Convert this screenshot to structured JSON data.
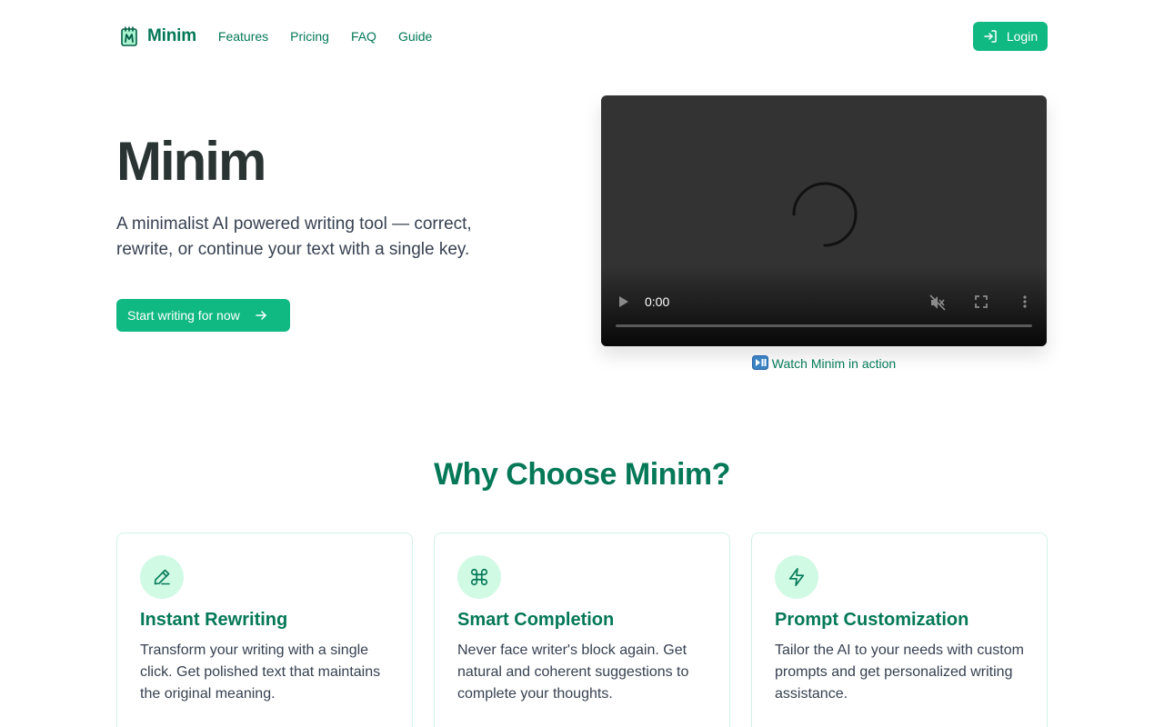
{
  "nav": {
    "brand": "Minim",
    "links": [
      "Features",
      "Pricing",
      "FAQ",
      "Guide"
    ],
    "login": "Login"
  },
  "hero": {
    "title": "Minim",
    "subtitle": "A minimalist AI powered writing tool — correct, rewrite, or continue your text with a single key.",
    "cta": "Start writing for now"
  },
  "video": {
    "time": "0:00",
    "caption": "Watch Minim in action",
    "progress": 0
  },
  "features": {
    "title": "Why Choose Minim?",
    "cards": [
      {
        "icon": "pencil-icon",
        "title": "Instant Rewriting",
        "desc": "Transform your writing with a single click. Get polished text that maintains the original meaning."
      },
      {
        "icon": "command-icon",
        "title": "Smart Completion",
        "desc": "Never face writer's block again. Get natural and coherent suggestions to complete your thoughts."
      },
      {
        "icon": "lightning-icon",
        "title": "Prompt Customization",
        "desc": "Tailor the AI to your needs with custom prompts and get personalized writing assistance."
      }
    ]
  },
  "colors": {
    "accent": "#10b981",
    "brand_text": "#047857",
    "icon_bg": "#d1fae5"
  }
}
